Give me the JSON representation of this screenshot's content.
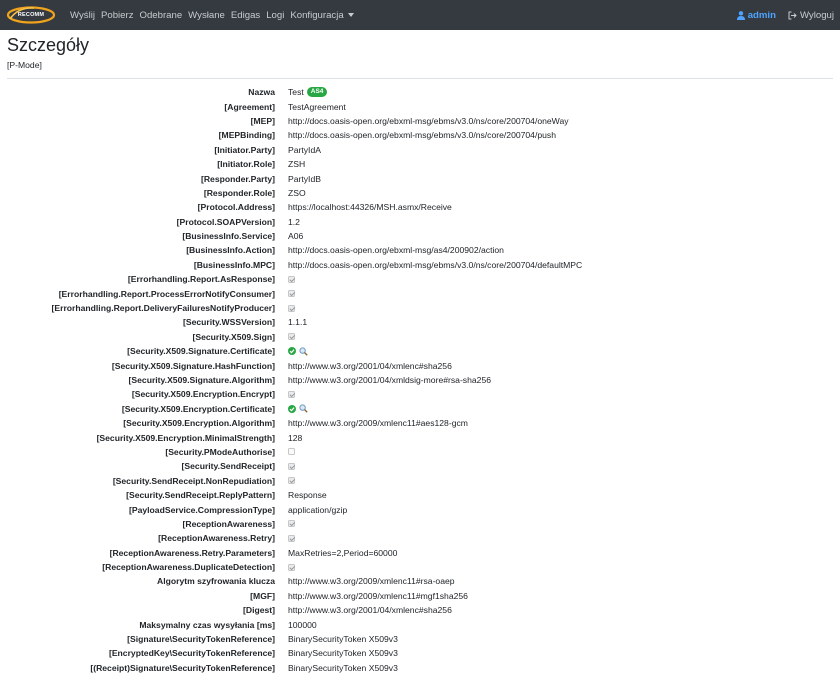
{
  "app": {
    "logo_text": "RECOMM"
  },
  "nav": {
    "items": [
      "Wyślij",
      "Pobierz",
      "Odebrane",
      "Wysłane",
      "Edigas",
      "Logi",
      "Konfiguracja"
    ],
    "user": "admin",
    "logout": "Wyloguj"
  },
  "page": {
    "title": "Szczegóły",
    "subtitle": "[P-Mode]"
  },
  "colors": {
    "navbar": "#343a40",
    "badge": "#28a745",
    "user": "#4da3ff",
    "ok": "#28a745"
  },
  "details": [
    {
      "label": "Nazwa",
      "value": "Test",
      "badge": "AS4"
    },
    {
      "label": "[Agreement]",
      "value": "TestAgreement"
    },
    {
      "label": "[MEP]",
      "value": "http://docs.oasis-open.org/ebxml-msg/ebms/v3.0/ns/core/200704/oneWay"
    },
    {
      "label": "[MEPBinding]",
      "value": "http://docs.oasis-open.org/ebxml-msg/ebms/v3.0/ns/core/200704/push"
    },
    {
      "label": "[Initiator.Party]",
      "value": "PartyIdA"
    },
    {
      "label": "[Initiator.Role]",
      "value": "ZSH"
    },
    {
      "label": "[Responder.Party]",
      "value": "PartyIdB"
    },
    {
      "label": "[Responder.Role]",
      "value": "ZSO"
    },
    {
      "label": "[Protocol.Address]",
      "value": "https://localhost:44326/MSH.asmx/Receive"
    },
    {
      "label": "[Protocol.SOAPVersion]",
      "value": "1.2"
    },
    {
      "label": "[BusinessInfo.Service]",
      "value": "A06"
    },
    {
      "label": "[BusinessInfo.Action]",
      "value": "http://docs.oasis-open.org/ebxml-msg/as4/200902/action"
    },
    {
      "label": "[BusinessInfo.MPC]",
      "value": "http://docs.oasis-open.org/ebxml-msg/ebms/v3.0/ns/core/200704/defaultMPC"
    },
    {
      "label": "[Errorhandling.Report.AsResponse]",
      "checkbox": true
    },
    {
      "label": "[Errorhandling.Report.ProcessErrorNotifyConsumer]",
      "checkbox": true
    },
    {
      "label": "[Errorhandling.Report.DeliveryFailuresNotifyProducer]",
      "checkbox": true
    },
    {
      "label": "[Security.WSSVersion]",
      "value": "1.1.1"
    },
    {
      "label": "[Security.X509.Sign]",
      "checkbox": true
    },
    {
      "label": "[Security.X509.Signature.Certificate]",
      "icons": [
        "check-circle-icon",
        "search-icon"
      ]
    },
    {
      "label": "[Security.X509.Signature.HashFunction]",
      "value": "http://www.w3.org/2001/04/xmlenc#sha256"
    },
    {
      "label": "[Security.X509.Signature.Algorithm]",
      "value": "http://www.w3.org/2001/04/xmldsig-more#rsa-sha256"
    },
    {
      "label": "[Security.X509.Encryption.Encrypt]",
      "checkbox": true
    },
    {
      "label": "[Security.X509.Encryption.Certificate]",
      "icons": [
        "check-circle-icon",
        "search-icon"
      ]
    },
    {
      "label": "[Security.X509.Encryption.Algorithm]",
      "value": "http://www.w3.org/2009/xmlenc11#aes128-gcm"
    },
    {
      "label": "[Security.X509.Encryption.MinimalStrength]",
      "value": "128"
    },
    {
      "label": "[Security.PModeAuthorise]",
      "checkbox": false
    },
    {
      "label": "[Security.SendReceipt]",
      "checkbox": true
    },
    {
      "label": "[Security.SendReceipt.NonRepudiation]",
      "checkbox": true
    },
    {
      "label": "[Security.SendReceipt.ReplyPattern]",
      "value": "Response"
    },
    {
      "label": "[PayloadService.CompressionType]",
      "value": "application/gzip"
    },
    {
      "label": "[ReceptionAwareness]",
      "checkbox": true
    },
    {
      "label": "[ReceptionAwareness.Retry]",
      "checkbox": true
    },
    {
      "label": "[ReceptionAwareness.Retry.Parameters]",
      "value": "MaxRetries=2,Period=60000"
    },
    {
      "label": "[ReceptionAwareness.DuplicateDetection]",
      "checkbox": true
    },
    {
      "label": "Algorytm szyfrowania klucza",
      "value": "http://www.w3.org/2009/xmlenc11#rsa-oaep"
    },
    {
      "label": "[MGF]",
      "value": "http://www.w3.org/2009/xmlenc11#mgf1sha256"
    },
    {
      "label": "[Digest]",
      "value": "http://www.w3.org/2001/04/xmlenc#sha256"
    },
    {
      "label": "Maksymalny czas wysyłania [ms]",
      "value": "100000"
    },
    {
      "label": "[Signature\\SecurityTokenReference]",
      "value": "BinarySecurityToken X509v3"
    },
    {
      "label": "[EncryptedKey\\SecurityTokenReference]",
      "value": "BinarySecurityToken X509v3"
    },
    {
      "label": "[(Receipt)Signature\\SecurityTokenReference]",
      "value": "BinarySecurityToken X509v3"
    }
  ]
}
